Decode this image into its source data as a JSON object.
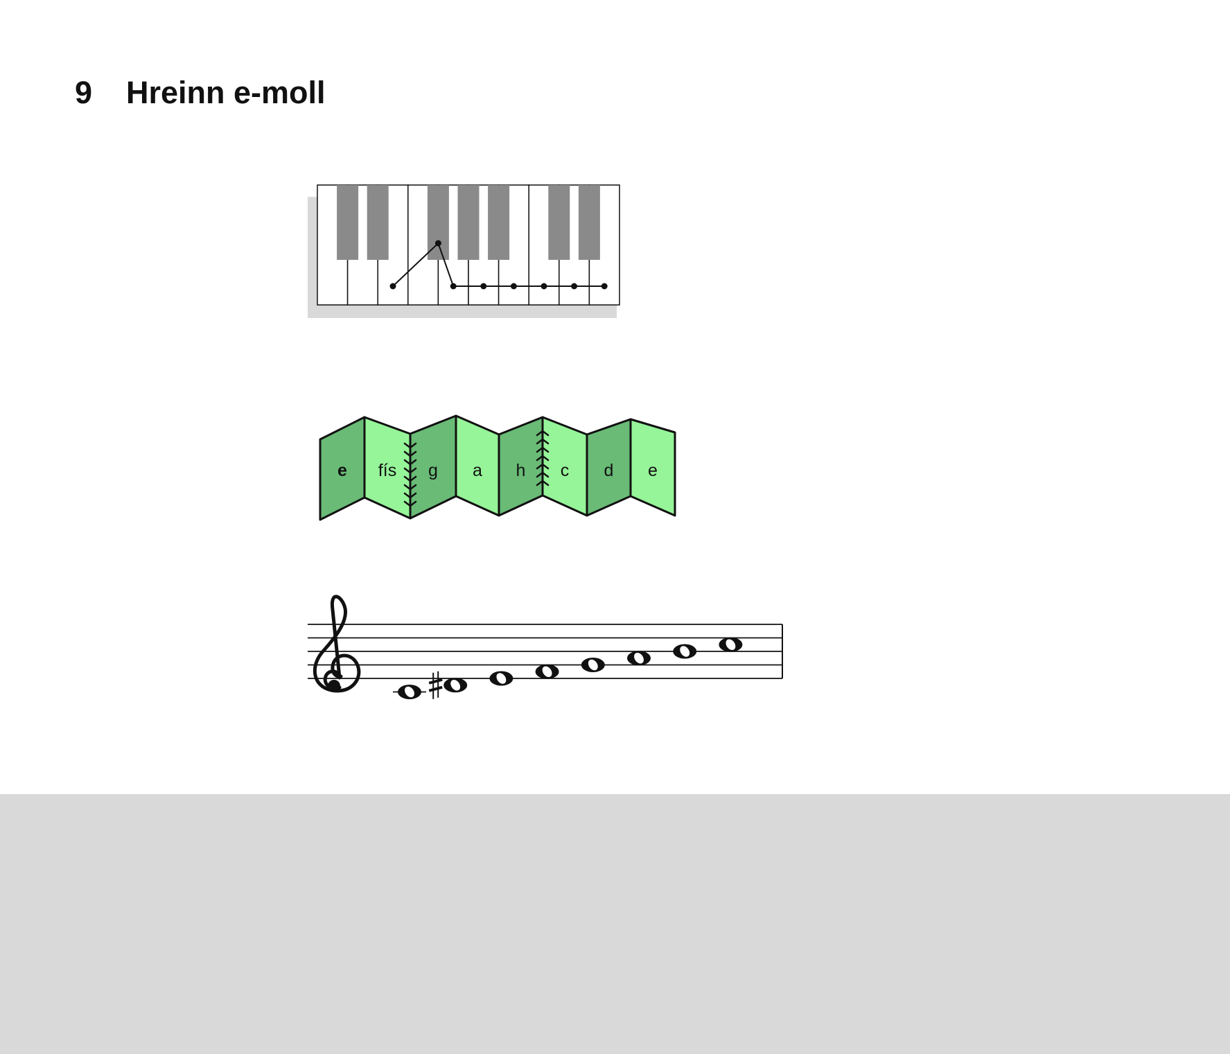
{
  "heading": {
    "number": "9",
    "title": "Hreinn e-moll"
  },
  "colors": {
    "panel_dark": "#69bb76",
    "panel_light": "#96f499",
    "black_key": "#8a8a8a",
    "outline": "#111111",
    "bottom_band": "#d9d9d9",
    "key_shadow": "#d9d9d9"
  },
  "keyboard": {
    "white_key_count": 10,
    "black_key_after_white": [
      0,
      1,
      3,
      4,
      5,
      7,
      8
    ],
    "pattern_white_keys": [
      2,
      4,
      5,
      6,
      7,
      8,
      9
    ],
    "pattern_raised_after_white": 3
  },
  "folds": [
    {
      "label": "e",
      "shade": "dark",
      "bold": true
    },
    {
      "label": "fís",
      "shade": "light",
      "bold": false
    },
    {
      "label": "g",
      "shade": "dark",
      "bold": false
    },
    {
      "label": "a",
      "shade": "light",
      "bold": false
    },
    {
      "label": "h",
      "shade": "dark",
      "bold": false
    },
    {
      "label": "c",
      "shade": "light",
      "bold": false
    },
    {
      "label": "d",
      "shade": "dark",
      "bold": false
    },
    {
      "label": "e",
      "shade": "light",
      "bold": false
    }
  ],
  "zippers": [
    2,
    5
  ],
  "staff": {
    "clef": "treble-clef",
    "notes": [
      {
        "step": -2,
        "accidental": ""
      },
      {
        "step": -1,
        "accidental": "sharp"
      },
      {
        "step": 0,
        "accidental": ""
      },
      {
        "step": 1,
        "accidental": ""
      },
      {
        "step": 2,
        "accidental": ""
      },
      {
        "step": 3,
        "accidental": ""
      },
      {
        "step": 4,
        "accidental": ""
      },
      {
        "step": 5,
        "accidental": ""
      }
    ]
  }
}
